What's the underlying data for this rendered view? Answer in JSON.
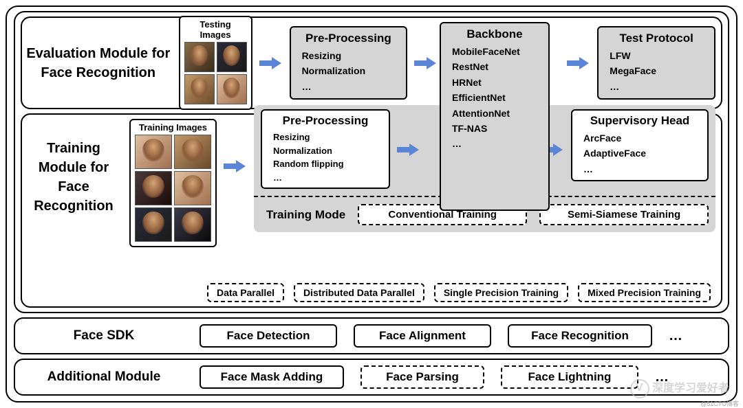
{
  "eval": {
    "title_l1": "Evaluation Module for",
    "title_l2": "Face Recognition",
    "images_title": "Testing Images",
    "pre": {
      "title": "Pre-Processing",
      "items": [
        "Resizing",
        "Normalization",
        "…"
      ]
    },
    "test": {
      "title": "Test Protocol",
      "items": [
        "LFW",
        "MegaFace",
        "…"
      ]
    }
  },
  "train": {
    "title_l1": "Training Module for",
    "title_l2": "Face Recognition",
    "images_title": "Training Images",
    "pre": {
      "title": "Pre-Processing",
      "items": [
        "Resizing",
        "Normalization",
        "Random flipping",
        "…"
      ]
    },
    "sup": {
      "title": "Supervisory Head",
      "items": [
        "ArcFace",
        "AdaptiveFace",
        "…"
      ]
    },
    "mode_label": "Training Mode",
    "mode_opts": [
      "Conventional Training",
      "Semi-Siamese Training"
    ],
    "dp": [
      "Data Parallel",
      "Distributed Data Parallel",
      "Single Precision Training",
      "Mixed Precision Training"
    ]
  },
  "backbone": {
    "title": "Backbone",
    "items": [
      "MobileFaceNet",
      "RestNet",
      "HRNet",
      "EfficientNet",
      "AttentionNet",
      "TF-NAS",
      "…"
    ]
  },
  "sdk": {
    "label": "Face SDK",
    "items": [
      "Face Detection",
      "Face Alignment",
      "Face Recognition"
    ],
    "more": "…"
  },
  "add": {
    "label": "Additional Module",
    "items": [
      "Face Mask Adding",
      "Face Parsing",
      "Face Lightning"
    ],
    "more": "…"
  },
  "watermark": "深度学习爱好者",
  "corner": "@51CTO博客"
}
